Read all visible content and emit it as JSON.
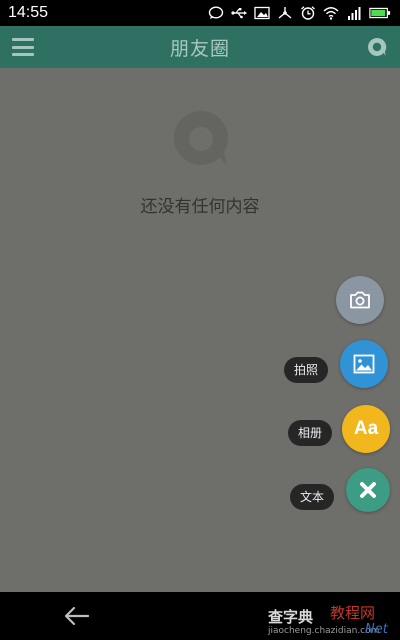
{
  "status_bar": {
    "time": "14:55",
    "battery_level": 0.95,
    "icons": [
      "chat-icon",
      "usb-icon",
      "image-icon",
      "network-icon",
      "alarm-icon",
      "wifi-icon",
      "signal-icon",
      "battery-icon"
    ]
  },
  "app_bar": {
    "title": "朋友圈",
    "color": "#2e7061",
    "icons": [
      "menu-icon",
      "moments-icon"
    ]
  },
  "content": {
    "empty_text": "还没有任何内容",
    "background": "#6e6e6b"
  },
  "actions": [
    {
      "label": "拍照",
      "icon": "camera-icon",
      "color": "#8a97a3"
    },
    {
      "label": "相册",
      "icon": "picture-icon",
      "color": "#2f93d6"
    },
    {
      "label": "文本",
      "icon": "text-icon",
      "glyph": "Aa",
      "color": "#f1b71c"
    }
  ],
  "close_action": {
    "icon": "close-icon",
    "color": "#3c9c84"
  },
  "nav_bar": {
    "back_icon": "back-arrow-icon"
  },
  "watermark": {
    "site_name": "查字典",
    "tag": "教程网",
    "domain": "jiaocheng.chazidian.com",
    "suffix": "Net"
  }
}
